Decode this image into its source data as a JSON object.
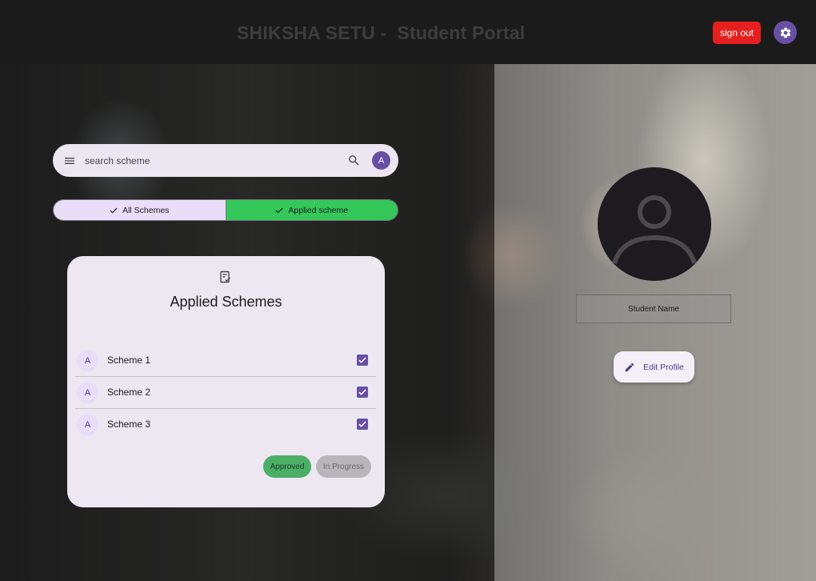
{
  "header": {
    "title": "SHIKSHA SETU -  Student Portal",
    "signout_label": "sign out",
    "settings_icon": "gear-icon"
  },
  "search": {
    "placeholder": "search scheme",
    "avatar_letter": "A"
  },
  "tabs": [
    {
      "label": "All Schemes",
      "selected": true
    },
    {
      "label": "Applied scheme",
      "selected": true
    }
  ],
  "card": {
    "icon": "clipboard-check-icon",
    "title": "Applied Schemes",
    "schemes": [
      {
        "avatar": "A",
        "name": "Scheme 1",
        "checked": true
      },
      {
        "avatar": "A",
        "name": "Scheme 2",
        "checked": true
      },
      {
        "avatar": "A",
        "name": "Scheme 3",
        "checked": true
      }
    ],
    "filters": {
      "approved": "Approved",
      "in_progress": "In Progress"
    }
  },
  "profile": {
    "avatar_icon": "person-icon",
    "student_name": "Student Name",
    "edit_label": "Edit Profile"
  },
  "colors": {
    "primary": "#6750a4",
    "signout": "#e5201f",
    "applied_tab": "#34c759",
    "approved_chip": "#4caf68"
  }
}
